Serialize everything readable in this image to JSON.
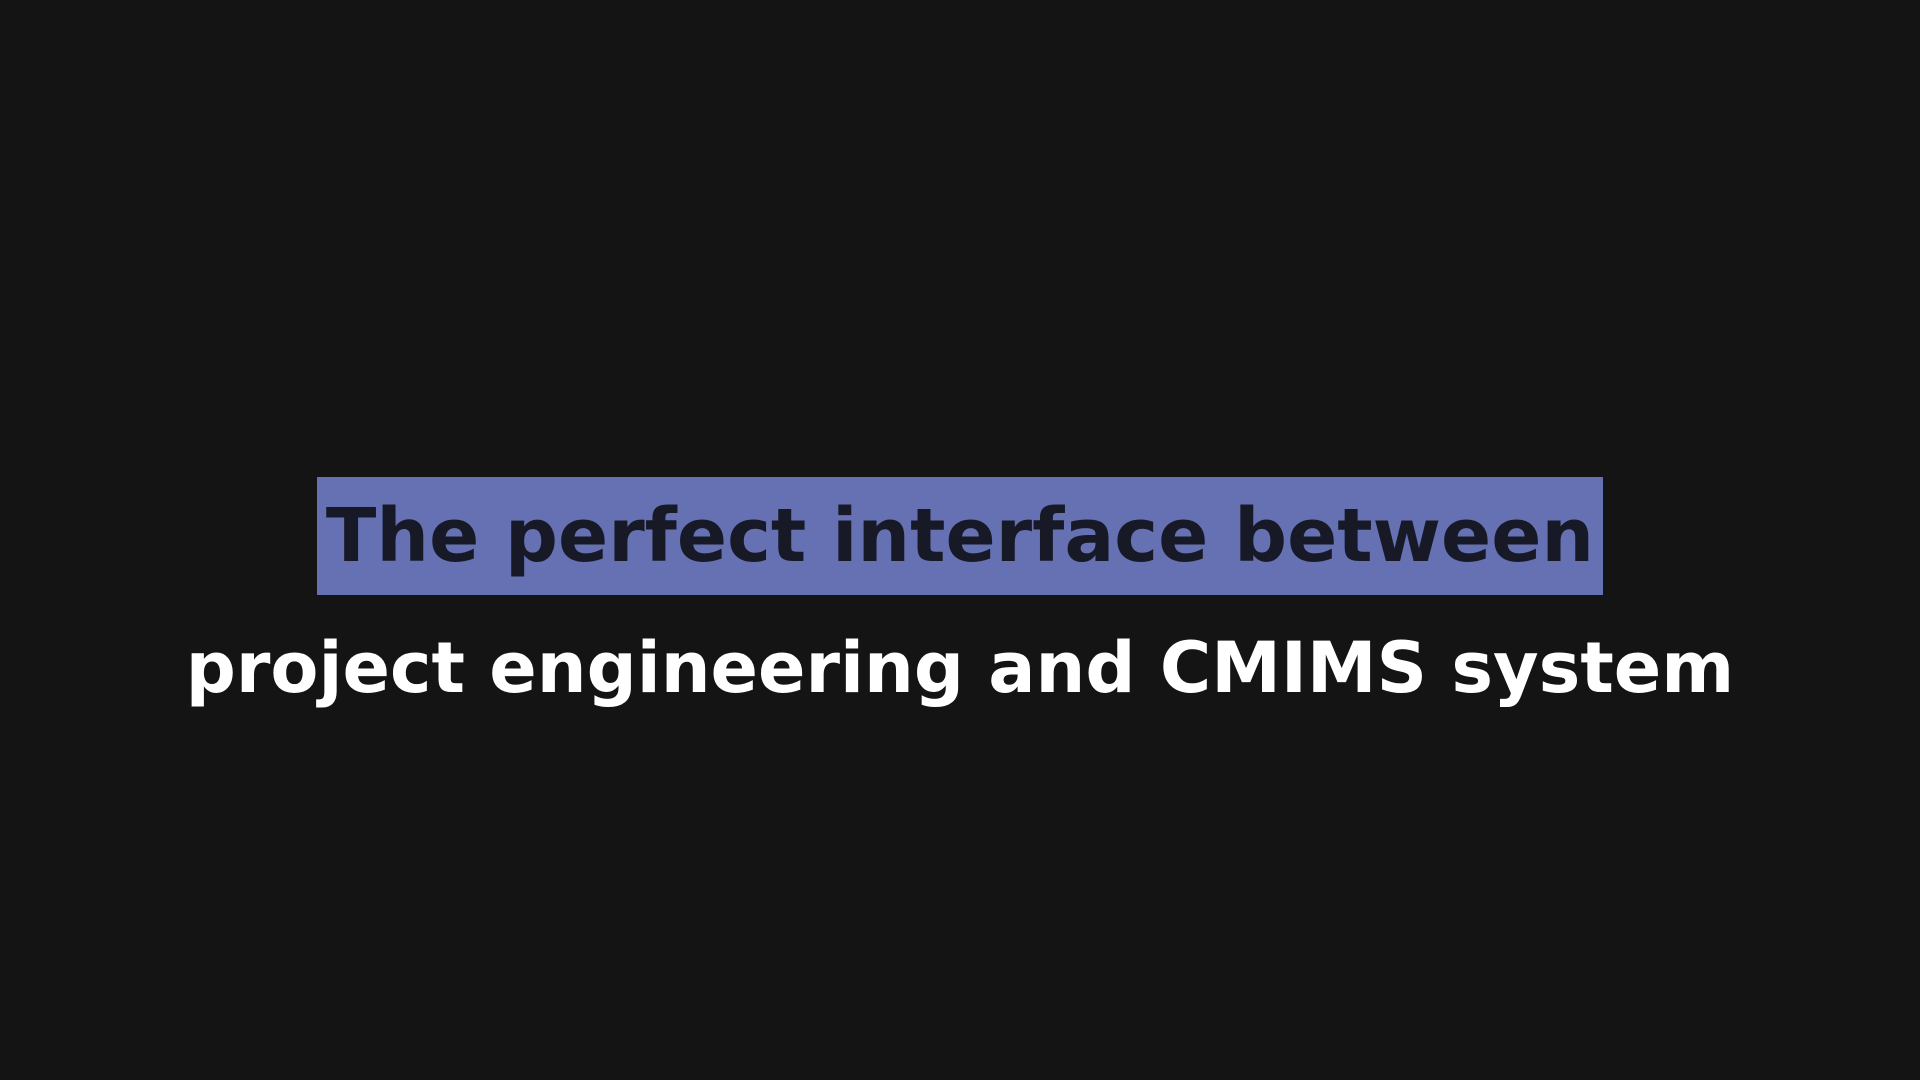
{
  "slide": {
    "headline": "The perfect interface between",
    "subline": "project engineering and CMIMS system"
  },
  "colors": {
    "background": "#141414",
    "highlight": "#6571b2",
    "headline_text": "#171a26",
    "subline_text": "#ffffff"
  }
}
